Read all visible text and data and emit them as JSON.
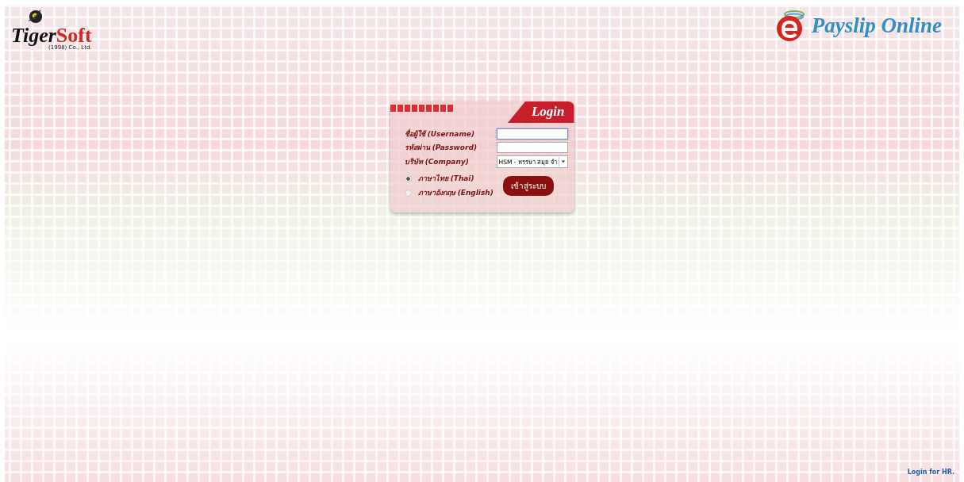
{
  "brand": {
    "name_part1": "Tiger",
    "name_part2": "Soft",
    "subtitle": "(1998) Co., Ltd."
  },
  "app_logo": {
    "title": "Payslip Online"
  },
  "login": {
    "title": "Login",
    "fields": [
      {
        "kind": "text",
        "label": "ชื่อผู้ใช้ (Username)",
        "focused": true
      },
      {
        "kind": "password",
        "label": "รหัสผ่าน (Password)",
        "focused": false
      },
      {
        "kind": "select",
        "label": "บริษัท (Company)",
        "value": "HSM - หรรษา สมุย จำ",
        "focused": false
      }
    ],
    "languages": [
      {
        "label": "ภาษาไทย (Thai)",
        "selected": true
      },
      {
        "label": "ภาษาอังกฤษ (English)",
        "selected": false
      }
    ],
    "submit": "เข้าสู่ระบบ"
  },
  "footer": {
    "link": "Login for HR."
  }
}
